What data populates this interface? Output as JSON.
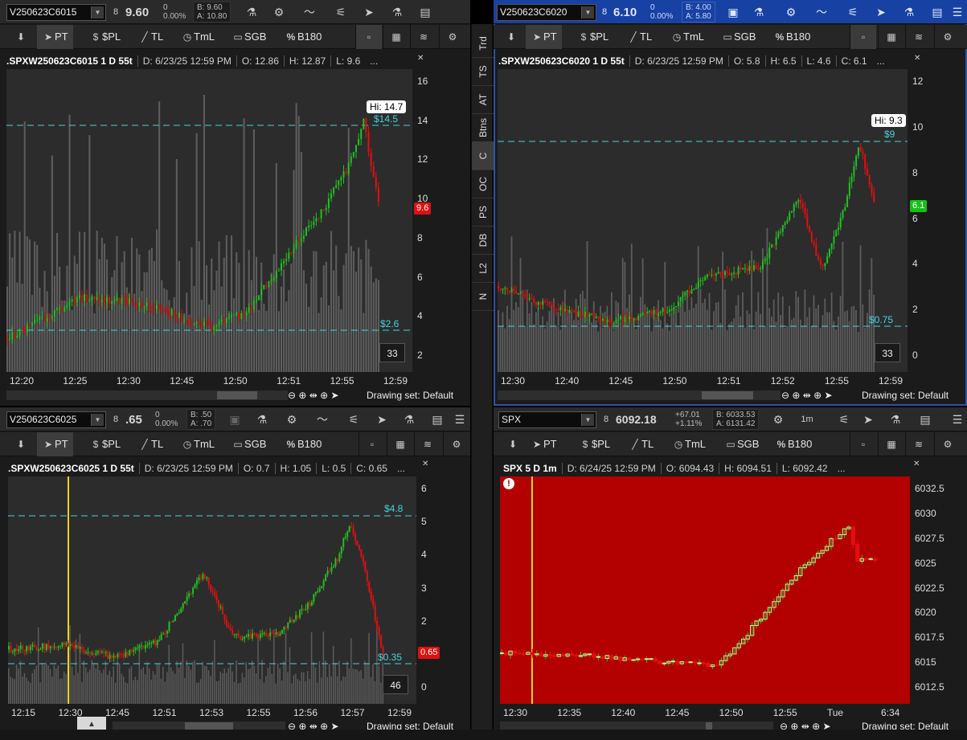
{
  "panes": [
    {
      "id": "tl",
      "symbol": "V250623C6015",
      "last": "9.60",
      "change": "0",
      "change_pct": "0.00%",
      "bid": "B: 9.60",
      "ask": "A: 10.80",
      "description": ".SPXW250623C6015 1 D 55t",
      "date": "D: 6/23/25 12:59 PM",
      "open": "O: 12.86",
      "high": "H: 12.87",
      "low": "L: 9.6",
      "extra": "...",
      "hi_label": "Hi: 14.7",
      "level_top": "$14.5",
      "level_bottom": "$2.6",
      "price_tag": "9.6",
      "price_tag_color": "#e01010",
      "badge": "33",
      "y_ticks": [
        "16",
        "14",
        "12",
        "10",
        "8",
        "6",
        "4",
        "2"
      ],
      "x_ticks": [
        "12:20",
        "12:25",
        "12:30",
        "12:45",
        "12:50",
        "12:51",
        "12:55",
        "12:59"
      ],
      "drawing_set": "Drawing set: Default"
    },
    {
      "id": "tr",
      "symbol": "V250623C6020",
      "last": "6.10",
      "change": "0",
      "change_pct": "0.00%",
      "bid": "B: 4.00",
      "ask": "A: 5.80",
      "description": ".SPXW250623C6020 1 D 55t",
      "date": "D: 6/23/25 12:59 PM",
      "open": "O: 5.8",
      "high": "H: 6.5",
      "low": "L: 4.6",
      "close": "C: 6.1",
      "extra": "...",
      "hi_label": "Hi: 9.3",
      "level_top": "$9",
      "level_bottom": "$0.75",
      "price_tag": "6.1",
      "price_tag_color": "#17c017",
      "badge": "33",
      "y_ticks": [
        "12",
        "10",
        "8",
        "6",
        "4",
        "2",
        "0"
      ],
      "x_ticks": [
        "12:30",
        "12:40",
        "12:45",
        "12:50",
        "12:51",
        "12:52",
        "12:55",
        "12:59"
      ],
      "drawing_set": "Drawing set: Default"
    },
    {
      "id": "bl",
      "symbol": "V250623C6025",
      "last": ".65",
      "change": "0",
      "change_pct": "0.00%",
      "bid": "B: .50",
      "ask": "A: .70",
      "description": ".SPXW250623C6025 1 D 55t",
      "date": "D: 6/23/25 12:59 PM",
      "open": "O: 0.7",
      "high": "H: 1.05",
      "low": "L: 0.5",
      "close": "C: 0.65",
      "extra": "...",
      "level_top": "$4.8",
      "level_bottom": "$0.35",
      "price_tag": "0.65",
      "price_tag_color": "#e01010",
      "badge": "46",
      "y_ticks": [
        "6",
        "5",
        "4",
        "3",
        "2",
        "1",
        "0"
      ],
      "x_ticks": [
        "12:15",
        "12:30",
        "12:45",
        "12:51",
        "12:53",
        "12:55",
        "12:56",
        "12:57",
        "12:59"
      ],
      "drawing_set": "Drawing set: Default"
    },
    {
      "id": "br",
      "symbol": "SPX",
      "last": "6092.18",
      "change": "+67.01",
      "change_pct": "+1.11%",
      "bid": "B: 6033.53",
      "ask": "A: 6131.42",
      "description": "SPX 5 D 1m",
      "date": "D: 6/24/25 12:59 PM",
      "open": "O: 6094.43",
      "high": "H: 6094.51",
      "low": "L: 6092.42",
      "extra": "...",
      "y_ticks": [
        "6032.5",
        "6030",
        "6027.5",
        "6025",
        "6022.5",
        "6020",
        "6017.5",
        "6015",
        "6012.5"
      ],
      "x_ticks": [
        "12:30",
        "12:35",
        "12:40",
        "12:45",
        "12:50",
        "12:55",
        "Tue",
        "6:34"
      ],
      "drawing_set": "Drawing set: Default"
    }
  ],
  "toolbar": {
    "pt": "PT",
    "spl": "$PL",
    "tl": "TL",
    "tml": "TmL",
    "sgb": "SGB",
    "b180": "B180"
  },
  "timeframe": "1m",
  "sidebar_tabs": [
    "Trd",
    "TS",
    "AT",
    "Btns",
    "C",
    "OC",
    "PS",
    "DB",
    "L2",
    "N"
  ],
  "colors": {
    "up": "#22c022",
    "down": "#e01010",
    "level": "#44d3df",
    "volume": "#6a6a6a",
    "marker": "#f0d020",
    "spx_bg": "#b30000"
  }
}
